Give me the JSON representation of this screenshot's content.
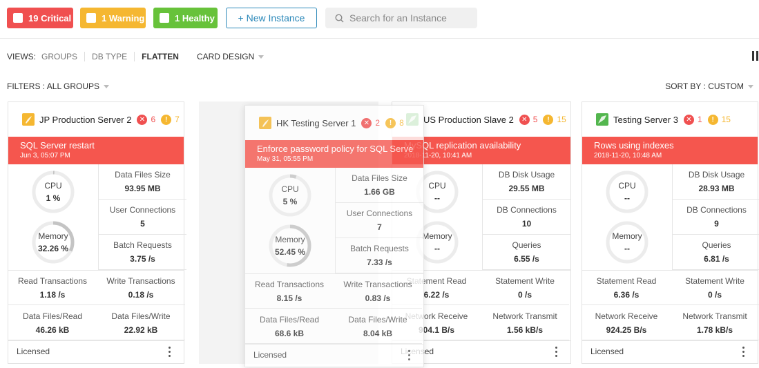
{
  "topbar": {
    "critical_label": "19 Critical",
    "warning_label": "1 Warning",
    "healthy_label": "1 Healthy",
    "new_instance_label": "+ New Instance",
    "search_placeholder": "Search for an Instance"
  },
  "views": {
    "label": "VIEWS:",
    "options": [
      "GROUPS",
      "DB TYPE",
      "FLATTEN"
    ],
    "active": "FLATTEN",
    "card_design_label": "CARD DESIGN"
  },
  "filters_label": "FILTERS : ALL GROUPS",
  "sort_label": "SORT BY : CUSTOM",
  "colors": {
    "critical": "#f05050",
    "warning": "#f5b731",
    "healthy": "#67c23a",
    "accent": "#2b88b9",
    "alert_bar": "#f5564e"
  },
  "cards": [
    {
      "icon": "sql-server-icon",
      "name": "JP Production Server 2",
      "critical": "6",
      "warning": "7",
      "alert_title": "SQL Server restart",
      "alert_date": "Jun 3, 05:07 PM",
      "gauges": [
        {
          "label": "CPU",
          "value": "1 %",
          "percent": 1
        },
        {
          "label": "Memory",
          "value": "32.26 %",
          "percent": 32.26
        }
      ],
      "metrics": [
        {
          "label": "Data Files Size",
          "value": "93.95 MB"
        },
        {
          "label": "User Connections",
          "value": "5"
        },
        {
          "label": "Batch Requests",
          "value": "3.75 /s"
        }
      ],
      "bottom": [
        {
          "label": "Read Transactions",
          "value": "1.18 /s"
        },
        {
          "label": "Write Transactions",
          "value": "0.18 /s"
        },
        {
          "label": "Data Files/Read",
          "value": "46.26 kB"
        },
        {
          "label": "Data Files/Write",
          "value": "22.92 kB"
        }
      ],
      "footer": "Licensed"
    },
    {
      "icon": "mysql-icon",
      "name": "US Production Slave 2",
      "critical": "5",
      "warning": "15",
      "alert_title": "MySQL replication availability",
      "alert_date": "2018-11-20, 10:41 AM",
      "gauges": [
        {
          "label": "CPU",
          "value": "--",
          "percent": 0
        },
        {
          "label": "Memory",
          "value": "--",
          "percent": 0
        }
      ],
      "metrics": [
        {
          "label": "DB Disk Usage",
          "value": "29.55 MB"
        },
        {
          "label": "DB Connections",
          "value": "10"
        },
        {
          "label": "Queries",
          "value": "6.55 /s"
        }
      ],
      "bottom": [
        {
          "label": "Statement Read",
          "value": "6.22 /s"
        },
        {
          "label": "Statement Write",
          "value": "0 /s"
        },
        {
          "label": "Network Receive",
          "value": "904.1 B/s"
        },
        {
          "label": "Network Transmit",
          "value": "1.56 kB/s"
        }
      ],
      "footer": "Licensed"
    },
    {
      "icon": "mysql-icon",
      "name": "Testing Server 3",
      "critical": "1",
      "warning": "15",
      "alert_title": "Rows using indexes",
      "alert_date": "2018-11-20, 10:48 AM",
      "gauges": [
        {
          "label": "CPU",
          "value": "--",
          "percent": 0
        },
        {
          "label": "Memory",
          "value": "--",
          "percent": 0
        }
      ],
      "metrics": [
        {
          "label": "DB Disk Usage",
          "value": "28.93 MB"
        },
        {
          "label": "DB Connections",
          "value": "9"
        },
        {
          "label": "Queries",
          "value": "6.81 /s"
        }
      ],
      "bottom": [
        {
          "label": "Statement Read",
          "value": "6.36 /s"
        },
        {
          "label": "Statement Write",
          "value": "0 /s"
        },
        {
          "label": "Network Receive",
          "value": "924.25 B/s"
        },
        {
          "label": "Network Transmit",
          "value": "1.78 kB/s"
        }
      ],
      "footer": "Licensed"
    },
    {
      "icon": "sql-server-icon",
      "name": "HK Testing Server 1",
      "critical": "2",
      "warning": "8",
      "alert_title": "Enforce password policy for SQL Serve",
      "alert_date": "May 31, 05:55 PM",
      "gauges": [
        {
          "label": "CPU",
          "value": "5 %",
          "percent": 5
        },
        {
          "label": "Memory",
          "value": "52.45 %",
          "percent": 52.45
        }
      ],
      "metrics": [
        {
          "label": "Data Files Size",
          "value": "1.66 GB"
        },
        {
          "label": "User Connections",
          "value": "7"
        },
        {
          "label": "Batch Requests",
          "value": "7.33 /s"
        }
      ],
      "bottom": [
        {
          "label": "Read Transactions",
          "value": "8.15 /s"
        },
        {
          "label": "Write Transactions",
          "value": "0.83 /s"
        },
        {
          "label": "Data Files/Read",
          "value": "68.6 kB"
        },
        {
          "label": "Data Files/Write",
          "value": "8.04 kB"
        }
      ],
      "footer": "Licensed"
    }
  ]
}
